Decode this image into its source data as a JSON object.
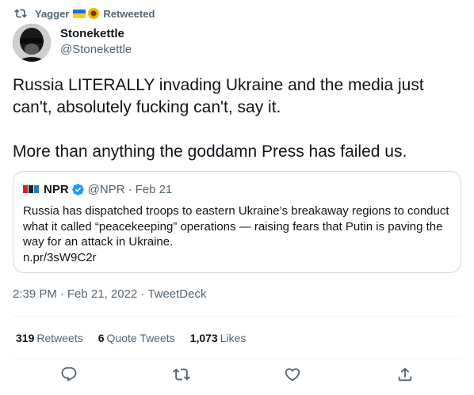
{
  "social_context": {
    "retweeter_name": "Yagger",
    "retweeted_label": "Retweeted"
  },
  "author": {
    "display_name": "Stonekettle",
    "handle": "@Stonekettle"
  },
  "tweet": {
    "paragraphs": [
      "Russia LITERALLY invading Ukraine and the media just can't, absolutely fucking can't, say it.",
      "More than anything the goddamn Press has failed us."
    ],
    "timestamp": "2:39 PM",
    "date": "Feb 21, 2022",
    "source": "TweetDeck"
  },
  "quoted_tweet": {
    "display_name": "NPR",
    "handle": "@NPR",
    "date": "Feb 21",
    "text": "Russia has dispatched troops to eastern Ukraine’s breakaway regions to conduct what it called “peacekeeping” operations — raising fears that Putin is paving the way for an attack in Ukraine.",
    "link": "n.pr/3sW9C2r"
  },
  "stats": {
    "retweets_count": "319",
    "retweets_label": "Retweets",
    "quote_tweets_count": "6",
    "quote_tweets_label": "Quote Tweets",
    "likes_count": "1,073",
    "likes_label": "Likes"
  },
  "colors": {
    "text_primary": "#0f1419",
    "text_secondary": "#536471",
    "border": "#cfd9de",
    "verified_blue": "#1d9bf0"
  },
  "icons": {
    "retweet_context": "retweet-icon",
    "verified": "verified-badge-icon",
    "reply": "reply-icon",
    "retweet": "retweet-icon",
    "like": "heart-icon",
    "share": "share-icon"
  }
}
